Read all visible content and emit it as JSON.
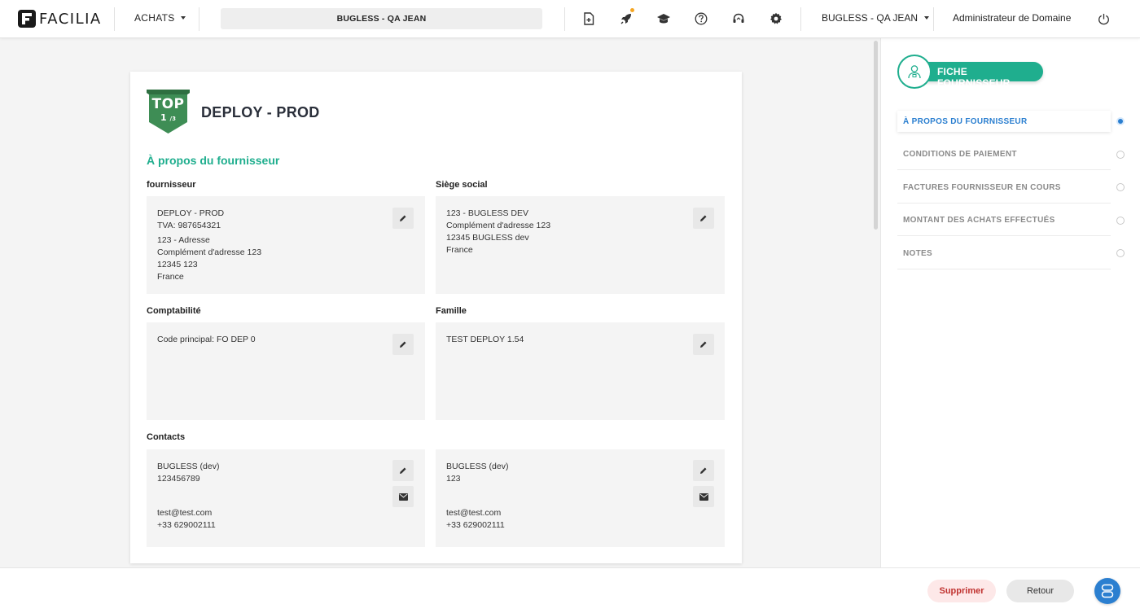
{
  "header": {
    "logo_text": "FACILIA",
    "module_menu": "ACHATS",
    "company_box": "BUGLESS - QA JEAN",
    "company_menu": "BUGLESS - QA JEAN",
    "user_role": "Administrateur de Domaine",
    "icons": [
      "new-document-icon",
      "rocket-icon",
      "graduation-cap-icon",
      "help-icon",
      "headset-icon",
      "gear-icon",
      "power-icon"
    ]
  },
  "supplier": {
    "badge_top": "TOP",
    "badge_rank": "1",
    "badge_rank_total": "/3",
    "name": "DEPLOY - PROD",
    "section_title": "À propos du fournisseur",
    "fournisseur": {
      "label": "fournisseur",
      "name": "DEPLOY - PROD",
      "tva": "TVA: 987654321",
      "address": "123 - Adresse",
      "address2": "Complément d'adresse 123",
      "city": "12345 123",
      "country": "France"
    },
    "siege": {
      "label": "Siège social",
      "address": "123 - BUGLESS DEV",
      "address2": "Complément d'adresse 123",
      "city": "12345 BUGLESS dev",
      "country": "France"
    },
    "comptabilite": {
      "label": "Comptabilité",
      "code": "Code principal: FO DEP 0"
    },
    "famille": {
      "label": "Famille",
      "value": "TEST DEPLOY 1.54"
    },
    "contacts": {
      "label": "Contacts",
      "items": [
        {
          "name": "BUGLESS (dev)",
          "phone_main": "123456789",
          "email": "test@test.com",
          "phone": "+33 629002111"
        },
        {
          "name": "BUGLESS (dev)",
          "phone_main": "123",
          "email": "test@test.com",
          "phone": "+33 629002111"
        }
      ]
    }
  },
  "right_panel": {
    "title": "FICHE FOURNISSEUR",
    "nav": [
      {
        "label": "À PROPOS DU FOURNISSEUR",
        "active": true
      },
      {
        "label": "CONDITIONS DE PAIEMENT",
        "active": false
      },
      {
        "label": "FACTURES FOURNISSEUR EN COURS",
        "active": false
      },
      {
        "label": "MONTANT DES ACHATS EFFECTUÉS",
        "active": false
      },
      {
        "label": "NOTES",
        "active": false
      }
    ]
  },
  "footer": {
    "delete_label": "Supprimer",
    "back_label": "Retour"
  },
  "colors": {
    "accent_green": "#1fae8e",
    "accent_blue": "#2b7fd0",
    "danger": "#c0322f",
    "badge_green": "#3e8d55"
  }
}
